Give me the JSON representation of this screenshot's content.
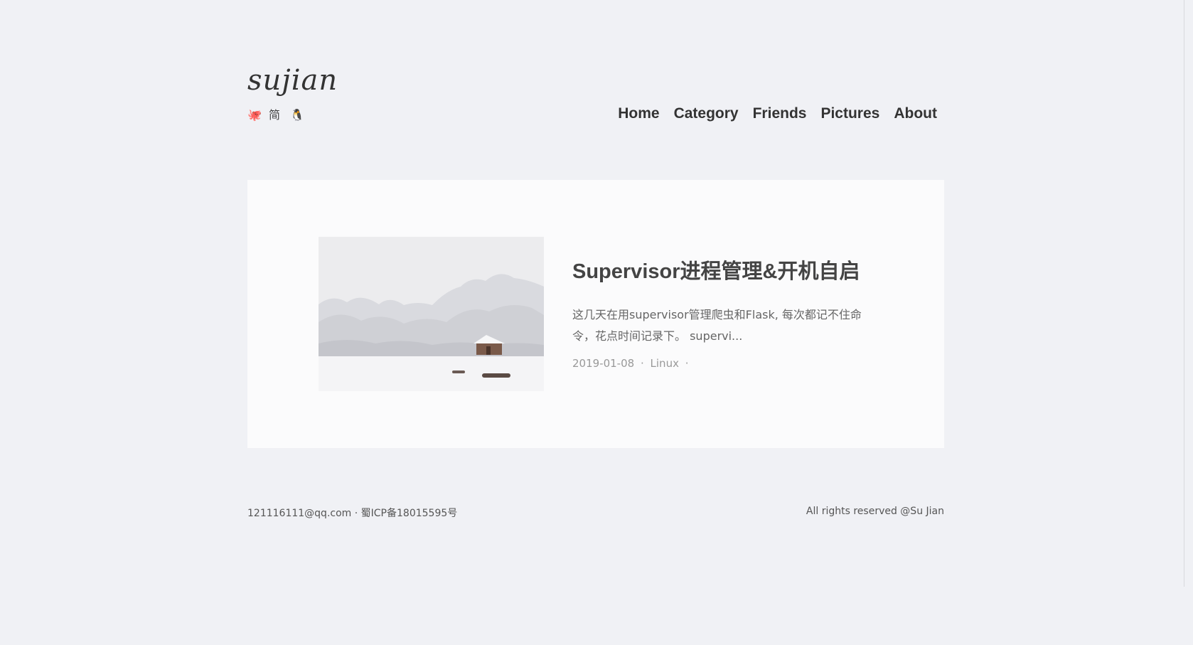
{
  "header": {
    "logo_text": "sujian",
    "social": [
      {
        "icon": "github-icon",
        "glyph": "🐙"
      },
      {
        "icon": "jianshu-icon",
        "glyph": "简"
      },
      {
        "icon": "qq-icon",
        "glyph": "🐧"
      }
    ],
    "nav": [
      "Home",
      "Category",
      "Friends",
      "Pictures",
      "About"
    ]
  },
  "post": {
    "title": "Supervisor进程管理&开机自启",
    "excerpt": "这几天在用supervisor管理爬虫和Flask, 每次都记不住命令，花点时间记录下。 supervi...",
    "date": "2019-01-08",
    "separator": "·",
    "category": "Linux"
  },
  "footer": {
    "email": "121116111@qq.com",
    "icp": "蜀ICP备18015595号",
    "separator": "·",
    "copyright": "All rights reserved @Su Jian"
  },
  "colors": {
    "background": "#f0f1f5",
    "card": "#fbfbfc",
    "text": "#444444",
    "muted": "#999999"
  }
}
